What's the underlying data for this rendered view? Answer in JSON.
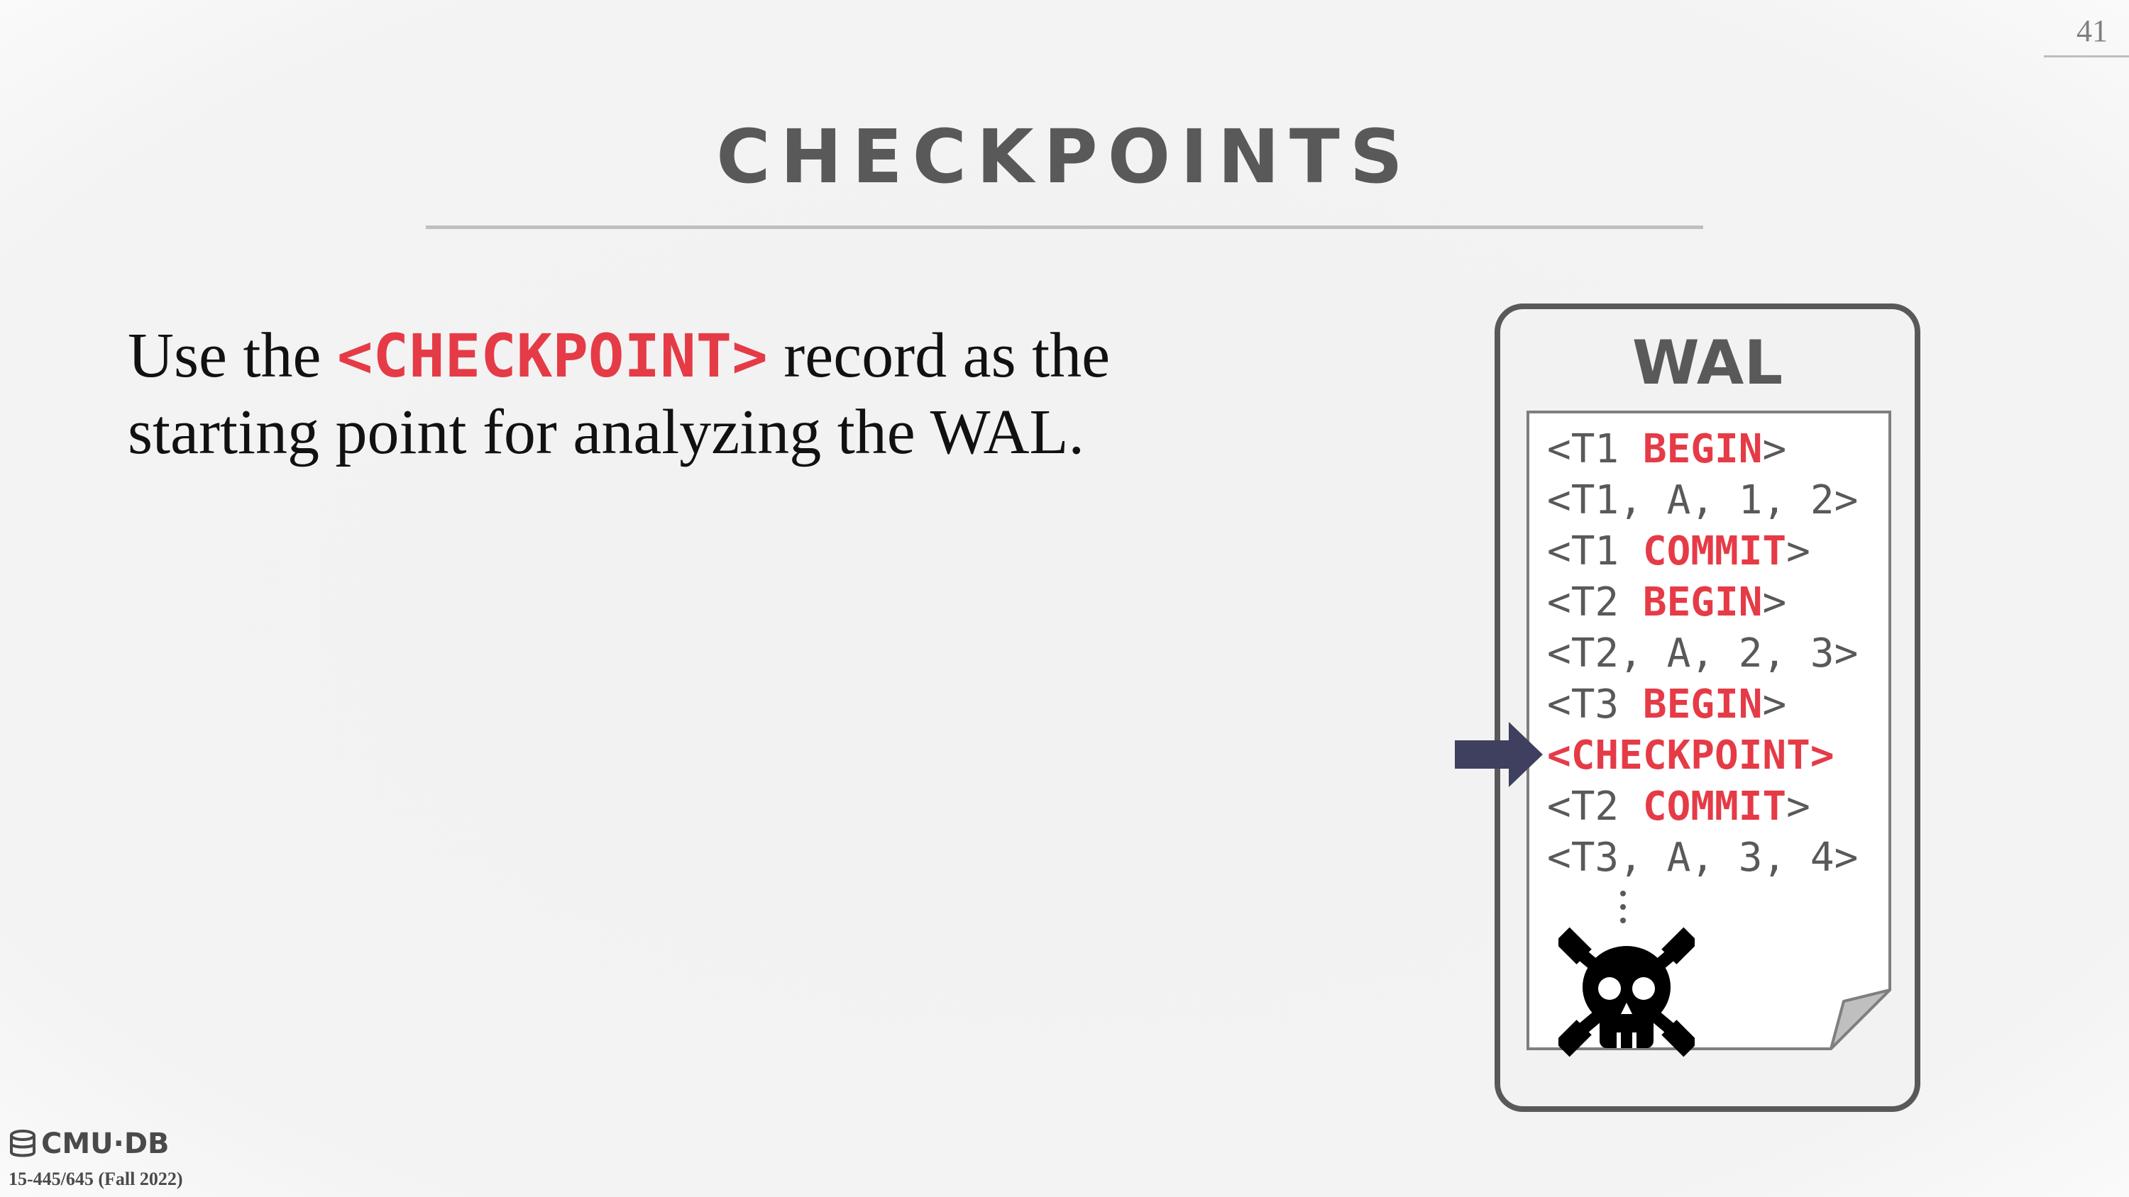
{
  "slide": {
    "page_number": "41",
    "title": "CHECKPOINTS",
    "body": {
      "prefix": "Use the ",
      "code": "<CHECKPOINT>",
      "suffix_line1": " record as the",
      "line2": "starting point for analyzing the WAL."
    },
    "wal": {
      "title": "WAL",
      "entries": [
        {
          "prefix": "<T1 ",
          "keyword": "BEGIN",
          "suffix": ">"
        },
        {
          "prefix": "<T1, A, 1, 2>",
          "keyword": "",
          "suffix": ""
        },
        {
          "prefix": "<T1 ",
          "keyword": "COMMIT",
          "suffix": ">"
        },
        {
          "prefix": "<T2 ",
          "keyword": "BEGIN",
          "suffix": ">"
        },
        {
          "prefix": "<T2, A, 2, 3>",
          "keyword": "",
          "suffix": ""
        },
        {
          "prefix": "<T3 ",
          "keyword": "BEGIN",
          "suffix": ">"
        },
        {
          "prefix": "",
          "keyword": "<CHECKPOINT>",
          "suffix": ""
        },
        {
          "prefix": "<T2 ",
          "keyword": "COMMIT",
          "suffix": ">"
        },
        {
          "prefix": "<T3, A, 3, 4>",
          "keyword": "",
          "suffix": ""
        }
      ],
      "pointer_icon": "right-arrow-icon",
      "crash_icon": "skull-crossbones-icon"
    },
    "footer": {
      "logo_text": "CMU·DB",
      "course": "15-445/645 (Fall 2022)"
    },
    "colors": {
      "accent": "#e53b47",
      "text_gray": "#595959",
      "arrow": "#3f3f5f"
    }
  }
}
